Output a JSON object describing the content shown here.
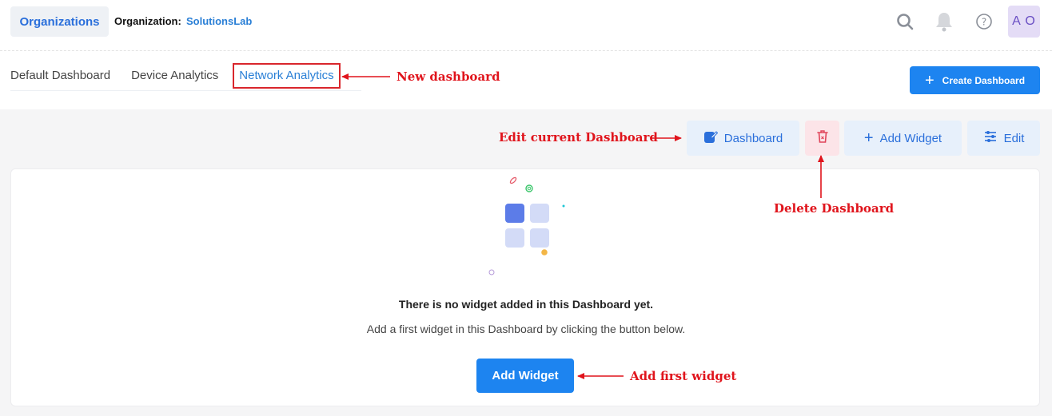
{
  "header": {
    "organizations_button": "Organizations",
    "organization_label": "Organization:",
    "organization_value": "SolutionsLab",
    "avatar_initials": "A O"
  },
  "tabs": [
    {
      "label": "Default Dashboard"
    },
    {
      "label": "Device Analytics"
    },
    {
      "label": "Network Analytics",
      "active": true
    }
  ],
  "toolbar": {
    "create_dashboard": "Create Dashboard",
    "dashboard": "Dashboard",
    "add_widget": "Add Widget",
    "edit": "Edit"
  },
  "empty_state": {
    "title": "There is no widget added in this Dashboard yet.",
    "subtitle": "Add a first widget in this Dashboard by clicking the button below.",
    "button": "Add Widget"
  },
  "annotations": {
    "new_dashboard": "New dashboard",
    "edit_current": "Edit current Dashboard",
    "delete_dashboard": "Delete Dashboard",
    "add_first_widget": "Add first widget"
  },
  "colors": {
    "primary": "#1d84f0",
    "link": "#2a7fd6",
    "annotation": "#e0141c",
    "delete_bg": "#fce4e8"
  },
  "icons": [
    "search-icon",
    "bell-icon",
    "help-icon",
    "edit-doc-icon",
    "trash-icon",
    "plus-icon",
    "sliders-icon"
  ]
}
